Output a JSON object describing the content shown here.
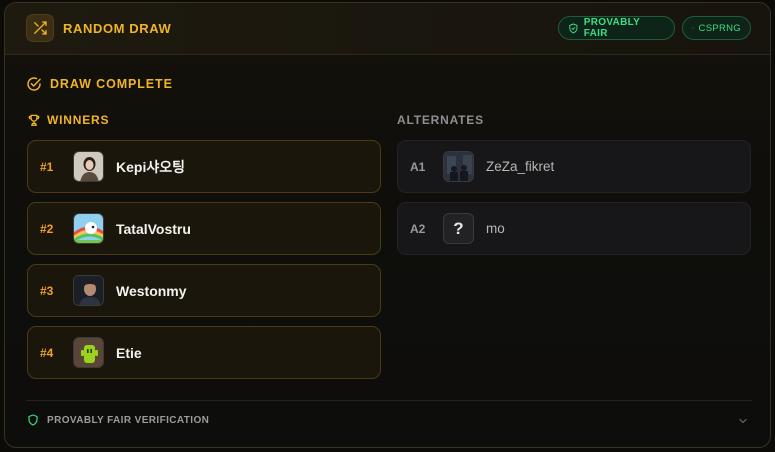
{
  "header": {
    "title": "RANDOM DRAW",
    "badges": {
      "fair": "PROVABLY FAIR",
      "csprng": "CSPRNG"
    }
  },
  "status": {
    "label": "DRAW COMPLETE"
  },
  "winners": {
    "title": "WINNERS",
    "items": [
      {
        "rank": "#1",
        "name": "Kepi샤오팅"
      },
      {
        "rank": "#2",
        "name": "TatalVostru"
      },
      {
        "rank": "#3",
        "name": "Westonmy"
      },
      {
        "rank": "#4",
        "name": "Etie"
      }
    ]
  },
  "alternates": {
    "title": "ALTERNATES",
    "items": [
      {
        "rank": "A1",
        "name": "ZeZa_fikret"
      },
      {
        "rank": "A2",
        "name": "mo",
        "avatar_placeholder": "?"
      }
    ]
  },
  "footer": {
    "verify_label": "PROVABLY FAIR VERIFICATION"
  },
  "colors": {
    "accent": "#f0b429",
    "success": "#3ddc84",
    "muted": "#8f8f92"
  },
  "icons": {
    "header": "shuffle-icon",
    "badge": "shield-check-icon",
    "status": "check-circle-icon",
    "winners": "trophy-icon",
    "footer": "shield-icon",
    "expand": "chevron-down-icon"
  }
}
